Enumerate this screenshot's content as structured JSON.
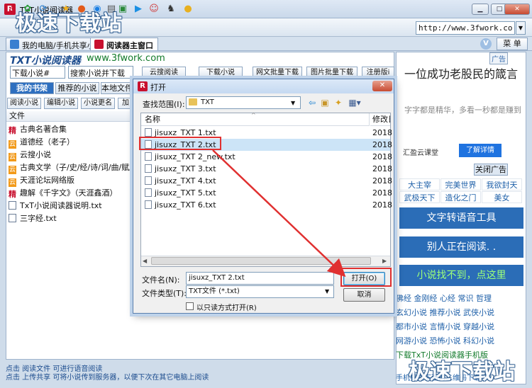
{
  "app": {
    "title": "TxT小说阅读器",
    "logo": "R"
  },
  "window": {
    "min": "▁",
    "max": "□",
    "close": "✕"
  },
  "toolbar": {
    "url": "http://www.3fwork.co",
    "icons": [
      "home-icon",
      "green-gear-icon",
      "refresh-icon",
      "star-icon",
      "orange-circle-icon",
      "blue-circle-icon",
      "page-icon",
      "screen-icon",
      "play-icon",
      "face-icon",
      "figure-icon",
      "chat-icon"
    ]
  },
  "tabs": [
    {
      "label": "我的电脑/手机共享小说"
    },
    {
      "label": "阅读器主窗口"
    }
  ],
  "tabbar": {
    "v": "V",
    "menu": "菜 单"
  },
  "left": {
    "brand": "TXT小说阅读器",
    "brand_url": "www.3fwork.com",
    "search_select": "下载小说#",
    "search_input": "搜索小说并下载",
    "header_buttons": [
      "云搜阅读",
      "下载小说",
      "网文批量下载",
      "图片批量下载",
      "注册版i"
    ],
    "tabs": [
      "我的书架",
      "推荐的小说",
      "本地文件"
    ],
    "sub_buttons": [
      "阅读小说",
      "编辑小说",
      "小说更名",
      "加"
    ],
    "list_header": "文件",
    "files": [
      {
        "icon": "精",
        "kind": "red",
        "name": "古典名著合集"
      },
      {
        "icon": "云",
        "kind": "orange",
        "name": "道德经（老子）"
      },
      {
        "icon": "云",
        "kind": "orange",
        "name": "云搜小说"
      },
      {
        "icon": "云",
        "kind": "orange",
        "name": "古典文学（子/史/经/诗/词/曲/赋/小说"
      },
      {
        "icon": "云",
        "kind": "orange",
        "name": "天涯论坛网络版"
      },
      {
        "icon": "精",
        "kind": "red",
        "name": "趣解《千字文》（天涯鑫酒）"
      },
      {
        "icon": "",
        "kind": "txt",
        "name": "TxT小说阅读器说明.txt"
      },
      {
        "icon": "",
        "kind": "txt",
        "name": "三字经.txt"
      }
    ],
    "status1": "点击 阅读文件 可进行语音阅读",
    "status2": "点击 上传共享 可将小说传到服务器，以便下次在其它电脑上阅读"
  },
  "ad": {
    "tag": "广告",
    "headline": "一位成功老股民的箴言",
    "sub": "字字都是精华，多看一秒都是赚到",
    "company": "汇盈云课堂",
    "detail": "了解详情",
    "close": "关闭广告",
    "grid": [
      "大主宰",
      "完美世界",
      "我欲封天",
      "武极天下",
      "造化之门",
      "美女"
    ],
    "bar1": "文字转语音工具",
    "bar2": "别人正在阅读. .",
    "bar3": "小说找不到，点这里",
    "links": [
      "佛经 金刚经 心经 常识 哲理",
      "玄幻小说 推荐小说 武侠小说",
      "都市小说 言情小说 穿越小说",
      "网游小说 恐怖小说 科幻小说"
    ],
    "green_link": "下载TxT小说阅读器手机版",
    "last_link": "手机扫描下面的二维码下载手"
  },
  "dialog": {
    "logo": "R",
    "title": "打开",
    "lookin_label": "查找范围(I):",
    "lookin_value": "TXT",
    "col_name": "名称",
    "col_date": "修改日",
    "files": [
      {
        "name": "jisuxz_TXT 1.txt",
        "date": "2018"
      },
      {
        "name": "jisuxz_TXT 2.txt",
        "date": "2018"
      },
      {
        "name": "jisuxz_TXT 2_new.txt",
        "date": "2018"
      },
      {
        "name": "jisuxz_TXT 3.txt",
        "date": "2018"
      },
      {
        "name": "jisuxz_TXT 4.txt",
        "date": "2018"
      },
      {
        "name": "jisuxz_TXT 5.txt",
        "date": "2018"
      },
      {
        "name": "jisuxz_TXT 6.txt",
        "date": "2018"
      }
    ],
    "fname_label": "文件名(N):",
    "fname_value": "jisuxz_TXT 2.txt",
    "ftype_label": "文件类型(T):",
    "ftype_value": "TXT文件 (*.txt)",
    "readonly": "以只读方式打开(R)",
    "open": "打开(O)",
    "cancel": "取消"
  },
  "watermark": "极速下载站",
  "colors": {
    "accent": "#2b6db7",
    "highlight": "#e03030",
    "brand": "#c8102e"
  }
}
